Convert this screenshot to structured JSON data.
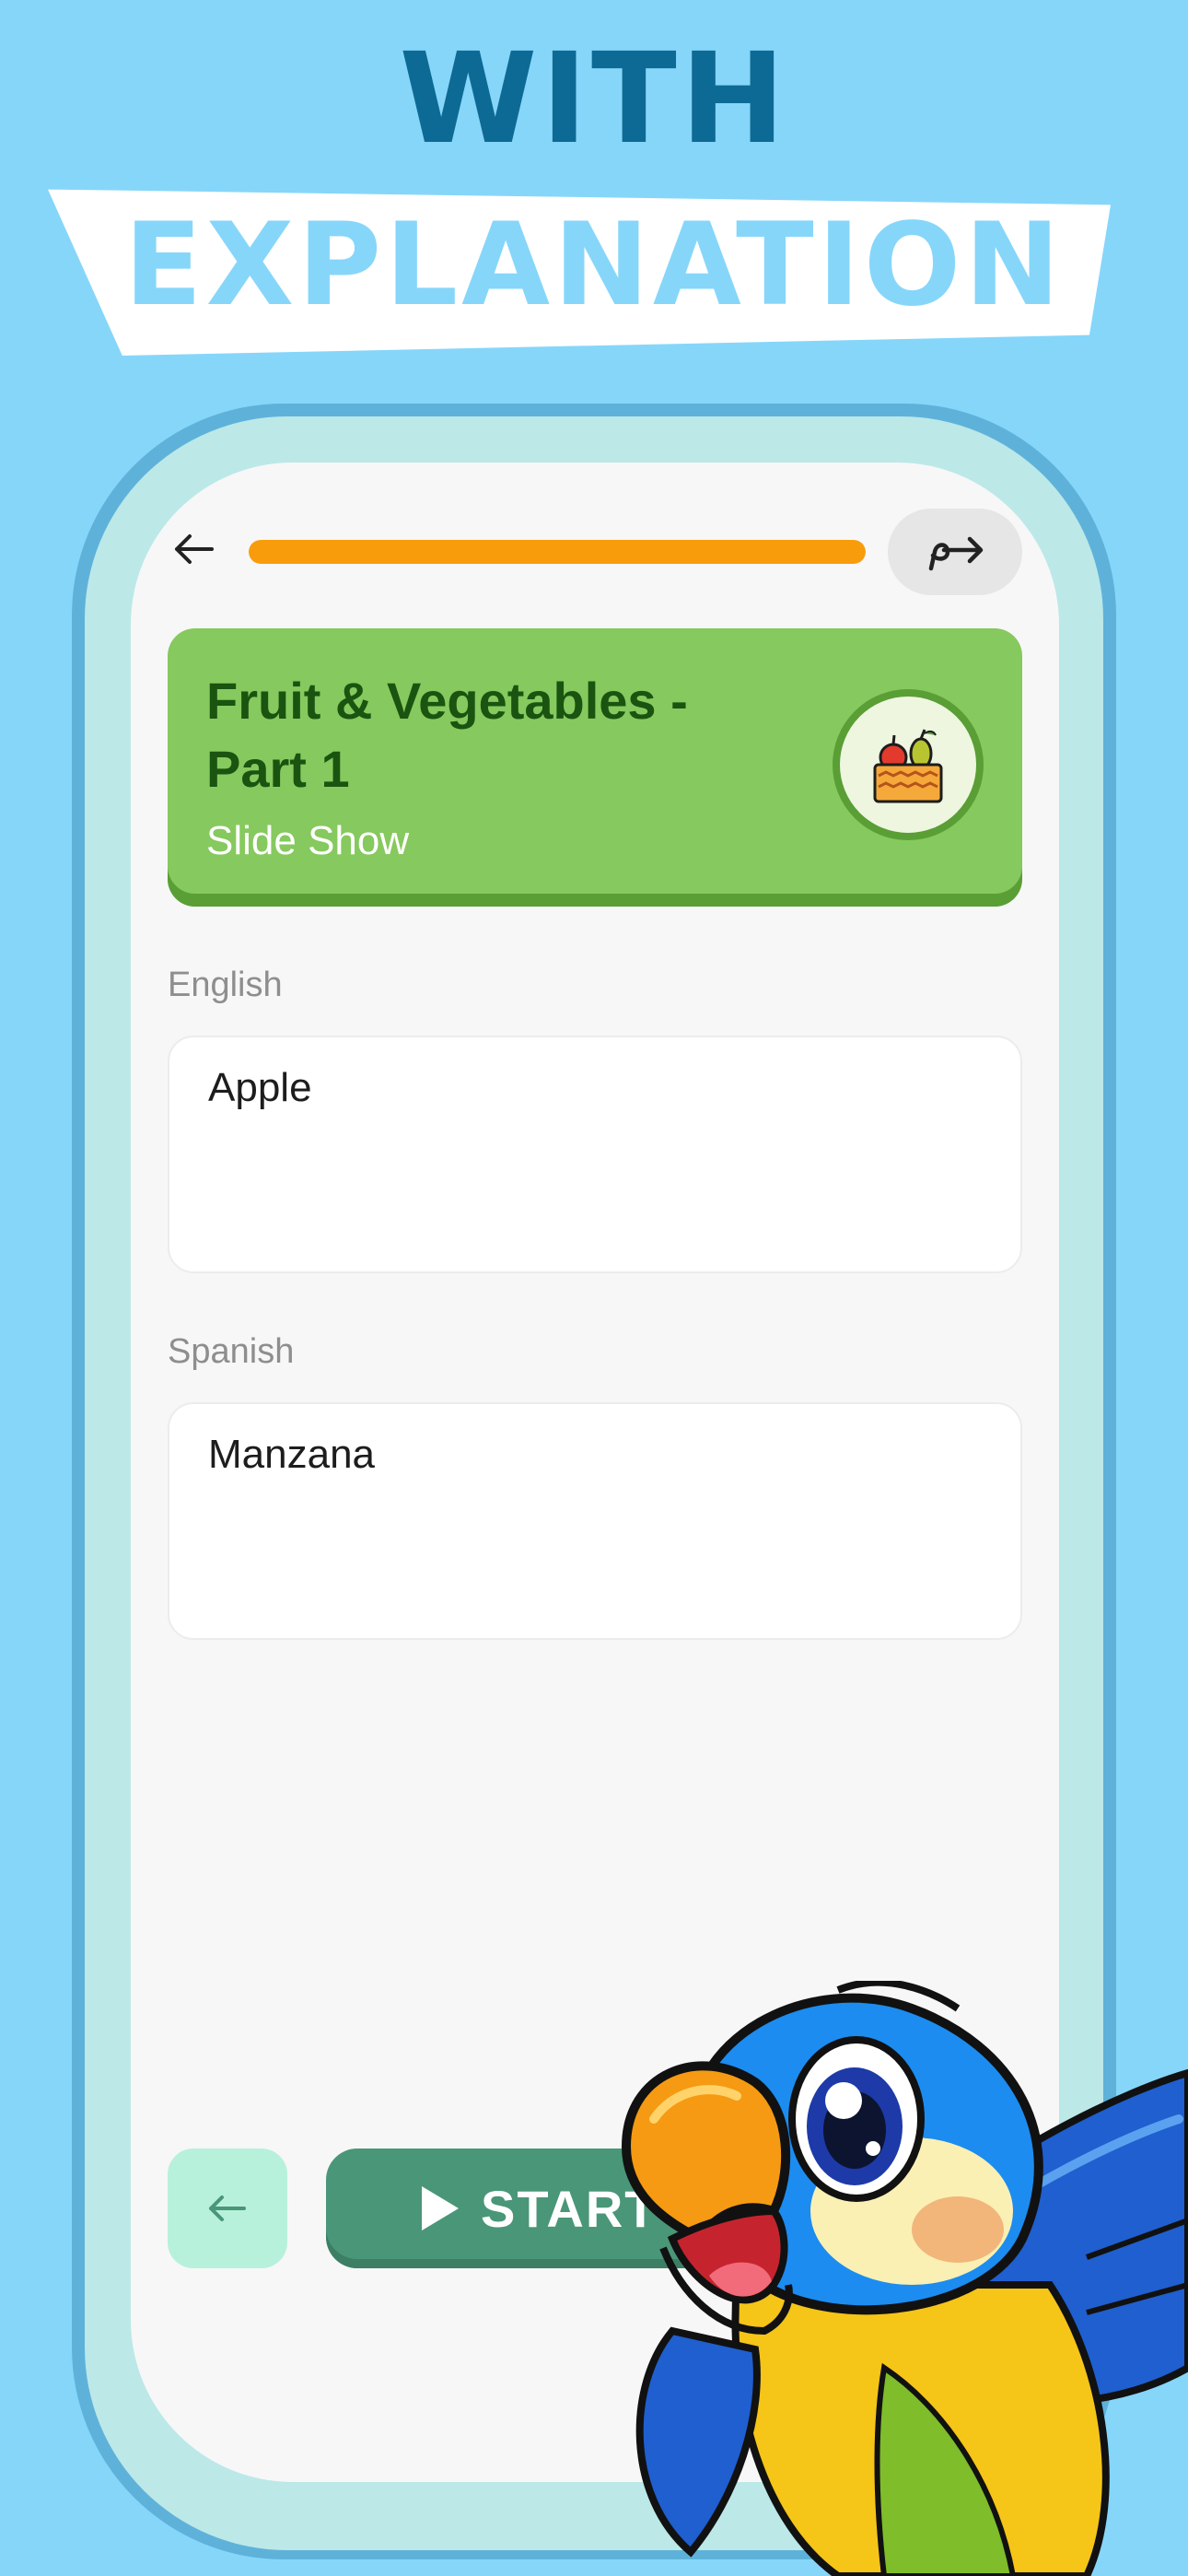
{
  "promo": {
    "title": "WITH",
    "subtitle": "EXPLANATION"
  },
  "header": {
    "back_icon": "arrow-left-icon",
    "progress": 1.0,
    "skip_icon": "skip-forward-icon"
  },
  "lesson": {
    "title": "Fruit & Vegetables - Part 1",
    "type": "Slide Show",
    "icon": "fruit-basket-icon"
  },
  "fields": [
    {
      "label": "English",
      "value": "Apple"
    },
    {
      "label": "Spanish",
      "value": "Manzana"
    }
  ],
  "footer": {
    "prev_icon": "arrow-left-icon",
    "start_label": "START",
    "start_icon": "play-icon"
  },
  "colors": {
    "background": "#86d6fa",
    "title": "#0d6a94",
    "progress": "#f99c0b",
    "card": "#86c95e",
    "card_title": "#1a5410",
    "start_button": "#4a9678",
    "prev_button": "#b7f1db"
  }
}
